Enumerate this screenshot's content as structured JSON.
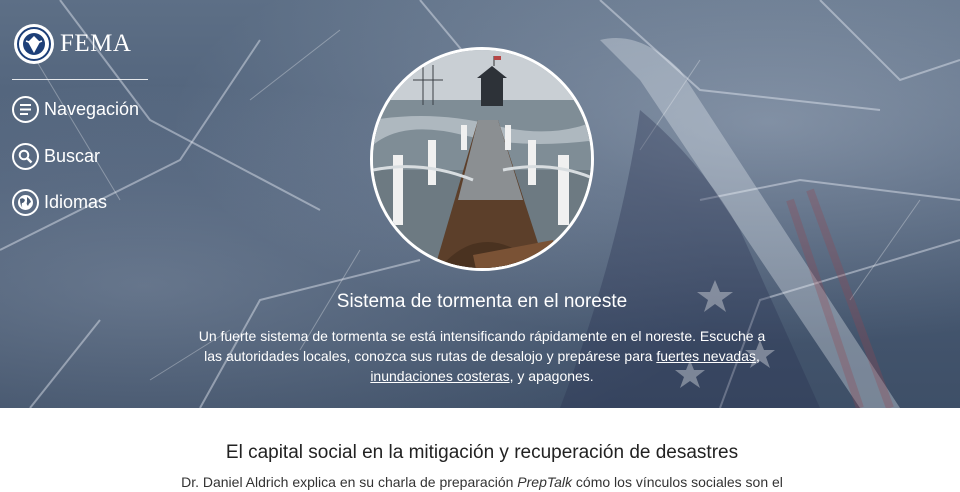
{
  "header": {
    "logo_text": "FEMA",
    "nav": [
      {
        "label": "Navegación",
        "icon": "menu-icon"
      },
      {
        "label": "Buscar",
        "icon": "search-icon"
      },
      {
        "label": "Idiomas",
        "icon": "globe-icon"
      }
    ]
  },
  "hero": {
    "title": "Sistema de tormenta en el noreste",
    "text_1": "Un fuerte sistema de tormenta se está intensificando rápidamente en el noreste. Escuche a las autoridades locales, conozca sus rutas de desalojo y prepárese para ",
    "link_snow": "fuertes nevadas",
    "text_2": ", ",
    "link_flood": "inundaciones costeras",
    "text_3": ", y apagones."
  },
  "feature": {
    "title": "El capital social en la mitigación y recuperación de desastres",
    "text_1": "Dr. Daniel Aldrich explica en su charla de preparación ",
    "text_em": "PrepTalk",
    "text_2": " cómo los vínculos sociales son el"
  },
  "colors": {
    "hero_overlay": "#4b5d76",
    "text_light": "#ffffff"
  }
}
